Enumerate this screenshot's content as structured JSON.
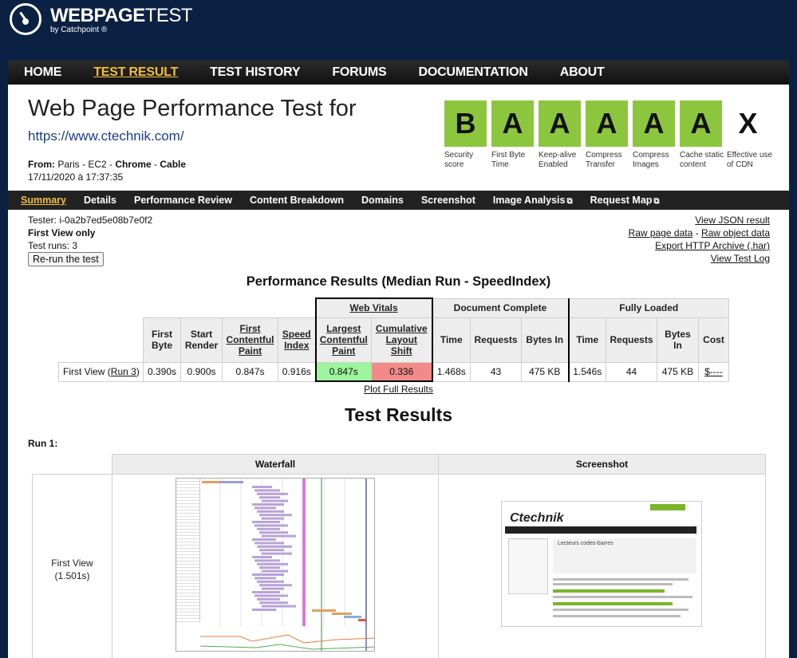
{
  "brand": {
    "name_bold": "WEBPAGE",
    "name_thin": "TEST",
    "sub": "by Catchpoint ®"
  },
  "nav": [
    "HOME",
    "TEST RESULT",
    "TEST HISTORY",
    "FORUMS",
    "DOCUMENTATION",
    "ABOUT"
  ],
  "nav_active": "TEST RESULT",
  "page": {
    "title": "Web Page Performance Test for",
    "url": "https://www.ctechnik.com/",
    "from_label": "From:",
    "from_value": "Paris - EC2 - ",
    "browser": "Chrome",
    "sep": " - ",
    "connection": "Cable",
    "date": "17/11/2020 à 17:37:35"
  },
  "grades": [
    {
      "grade": "B",
      "label": "Security score",
      "color": "#8cc63e"
    },
    {
      "grade": "A",
      "label": "First Byte Time",
      "color": "#8cc63e"
    },
    {
      "grade": "A",
      "label": "Keep-alive Enabled",
      "color": "#8cc63e"
    },
    {
      "grade": "A",
      "label": "Compress Transfer",
      "color": "#8cc63e"
    },
    {
      "grade": "A",
      "label": "Compress Images",
      "color": "#8cc63e"
    },
    {
      "grade": "A",
      "label": "Cache static content",
      "color": "#8cc63e"
    },
    {
      "grade": "X",
      "label": "Effective use of CDN",
      "color": "#ffffff"
    }
  ],
  "subnav": [
    {
      "label": "Summary",
      "active": true,
      "ext": false
    },
    {
      "label": "Details",
      "active": false,
      "ext": false
    },
    {
      "label": "Performance Review",
      "active": false,
      "ext": false
    },
    {
      "label": "Content Breakdown",
      "active": false,
      "ext": false
    },
    {
      "label": "Domains",
      "active": false,
      "ext": false
    },
    {
      "label": "Screenshot",
      "active": false,
      "ext": false
    },
    {
      "label": "Image Analysis",
      "active": false,
      "ext": true
    },
    {
      "label": "Request Map",
      "active": false,
      "ext": true
    }
  ],
  "tester": {
    "tester_line": "Tester: i-0a2b7ed5e08b7e0f2",
    "view": "First View only",
    "runs": "Test runs: 3",
    "rerun": "Re-run the test"
  },
  "right_links": [
    "View JSON result",
    "Raw page data",
    "Raw object data",
    "Export HTTP Archive (.har)",
    "View Test Log"
  ],
  "right_link_sep": " - ",
  "performance": {
    "title": "Performance Results (Median Run - SpeedIndex)",
    "groups": {
      "web_vitals": "Web Vitals",
      "doc_complete": "Document Complete",
      "fully_loaded": "Fully Loaded"
    },
    "columns": {
      "first_byte": "First Byte",
      "start_render": "Start Render",
      "fcp": "First Contentful Paint",
      "speed_index": "Speed Index",
      "lcp": "Largest Contentful Paint",
      "cls": "Cumulative Layout Shift",
      "time": "Time",
      "requests": "Requests",
      "bytes_in": "Bytes In",
      "cost": "Cost"
    },
    "row": {
      "label": "First View (",
      "run_link": "Run 3",
      "label_end": ")",
      "first_byte": "0.390s",
      "start_render": "0.900s",
      "fcp": "0.847s",
      "speed_index": "0.916s",
      "lcp": "0.847s",
      "cls": "0.336",
      "dc_time": "1.468s",
      "dc_requests": "43",
      "dc_bytes": "475 KB",
      "fl_time": "1.546s",
      "fl_requests": "44",
      "fl_bytes": "475 KB",
      "cost": "$----"
    },
    "plot_link": "Plot Full Results"
  },
  "results": {
    "title": "Test Results",
    "run_label": "Run 1:",
    "waterfall_header": "Waterfall",
    "screenshot_header": "Screenshot",
    "row_label": "First View",
    "row_time": "(1.501s)"
  },
  "screenshot_site": {
    "logo": "Ctechnik",
    "heading": "Lecteurs codes-barres"
  }
}
